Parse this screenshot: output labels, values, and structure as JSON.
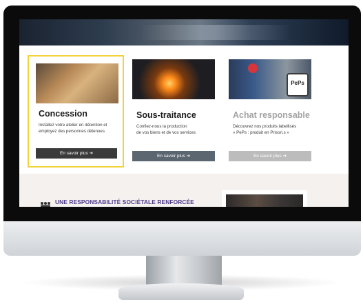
{
  "page": {
    "cards": [
      {
        "title": "Concession",
        "desc_line1": "Installez votre atelier en détention et",
        "desc_line2": "employez des personnes détenues",
        "button": "En savoir plus ➔"
      },
      {
        "title": "Sous-traitance",
        "desc_line1": "Confiez-nous la production",
        "desc_line2": "de vos biens et de vos services",
        "button": "En savoir plus ➔"
      },
      {
        "title": "Achat responsable",
        "desc_line1": "Découvrez nos produits labellisés",
        "desc_line2": "« PePs : produit en Prison.s »",
        "button": "En savoir plus ➔"
      }
    ],
    "badge_text": "PePs",
    "responsibility_heading": "UNE RESPONSABILITÉ SOCIÉTALE RENFORCÉE"
  },
  "colors": {
    "highlight": "#f2d33b",
    "button_dark": "#3a3a3a",
    "button_slate": "#5c6670",
    "button_light": "#bcbcbc",
    "heading_purple": "#4d3a8c"
  }
}
